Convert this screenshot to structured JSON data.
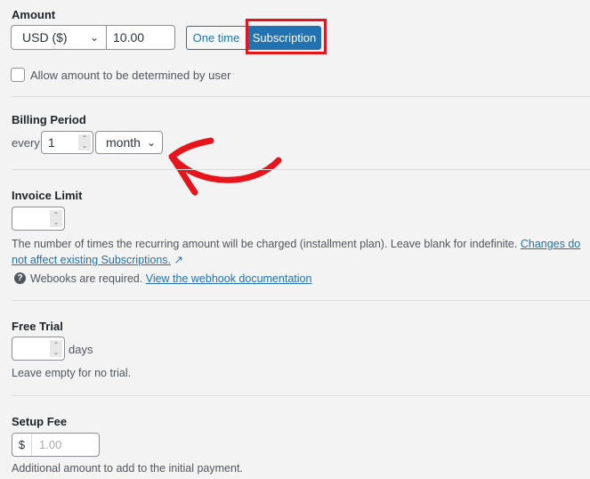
{
  "amount": {
    "label": "Amount",
    "currency": "USD ($)",
    "value": "10.00",
    "one_time": "One time",
    "subscription": "Subscription",
    "allow_user": "Allow amount to be determined by user"
  },
  "billing": {
    "label": "Billing Period",
    "every": "every",
    "interval": "1",
    "period": "month"
  },
  "invoice": {
    "label": "Invoice Limit",
    "value": "",
    "help": "The number of times the recurring amount will be charged (installment plan). Leave blank for indefinite.",
    "link": "Changes do not affect existing Subscriptions.",
    "webhook_text": "Webooks are required.",
    "webhook_link": "View the webhook documentation"
  },
  "trial": {
    "label": "Free Trial",
    "value": "",
    "unit": "days",
    "help": "Leave empty for no trial."
  },
  "setup": {
    "label": "Setup Fee",
    "currency_symbol": "$",
    "placeholder": "1.00",
    "help": "Additional amount to add to the initial payment."
  },
  "colors": {
    "accent": "#2271b1",
    "annotation": "#e8141b"
  }
}
